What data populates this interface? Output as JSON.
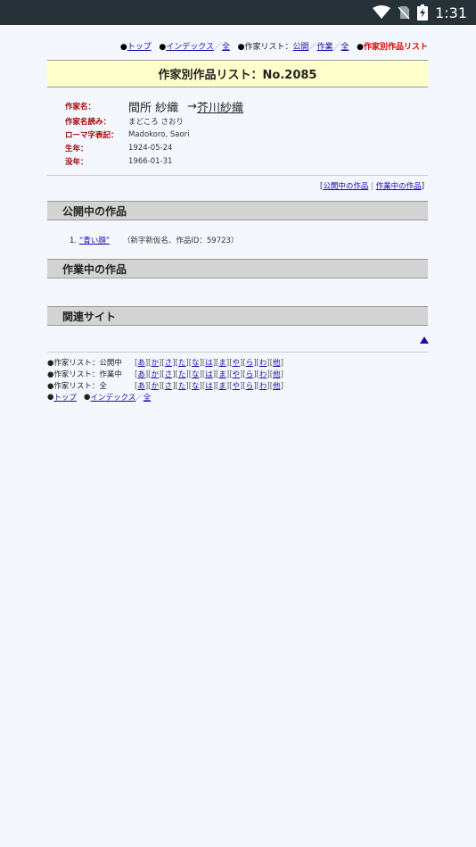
{
  "status_bar": {
    "time": "1:31"
  },
  "top_nav": {
    "top": "トップ",
    "index": "インデックス",
    "all1": "全",
    "author_list": "作家リスト：",
    "public": "公開",
    "working": "作業",
    "all2": "全",
    "current": "作家別作品リスト"
  },
  "title": "作家別作品リスト：No.2085",
  "author": {
    "name_label": "作家名：",
    "name": "間所 紗織",
    "arrow": "→",
    "alias": "芥川紗織",
    "reading_label": "作家名読み：",
    "reading": "まどころ さおり",
    "romaji_label": "ローマ字表記：",
    "romaji": "Madokoro, Saori",
    "born_label": "生年：",
    "born": "1924-05-24",
    "died_label": "没年：",
    "died": "1966-01-31"
  },
  "right_links": {
    "public_works": "公開中の作品",
    "working_works": "作業中の作品"
  },
  "sections": {
    "public": "公開中の作品",
    "working": "作業中の作品",
    "related": "関連サイト"
  },
  "works": [
    {
      "num": "1.",
      "title": "“青い顔”",
      "note": "（新字新仮名、作品ID：59723）"
    }
  ],
  "bottom_nav": {
    "row1_label": "●作家リスト：公開中",
    "row2_label": "●作家リスト：作業中",
    "row3_label": "●作家リスト：全",
    "kana": [
      "あ",
      "か",
      "さ",
      "た",
      "な",
      "は",
      "ま",
      "や",
      "ら",
      "わ",
      "他"
    ],
    "top": "トップ",
    "index": "インデックス",
    "all": "全"
  }
}
